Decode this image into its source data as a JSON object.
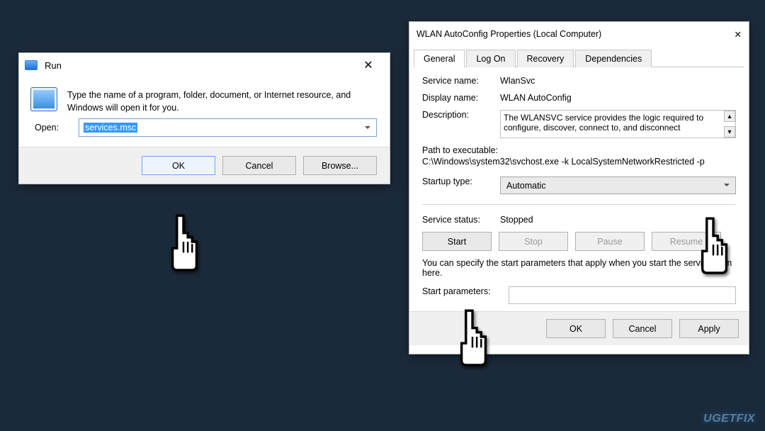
{
  "run": {
    "title": "Run",
    "message": "Type the name of a program, folder, document, or Internet resource, and Windows will open it for you.",
    "open_label": "Open:",
    "open_value": "services.msc",
    "ok": "OK",
    "cancel": "Cancel",
    "browse": "Browse..."
  },
  "props": {
    "title": "WLAN AutoConfig Properties (Local Computer)",
    "tabs": [
      "General",
      "Log On",
      "Recovery",
      "Dependencies"
    ],
    "service_name_label": "Service name:",
    "service_name": "WlanSvc",
    "display_name_label": "Display name:",
    "display_name": "WLAN AutoConfig",
    "description_label": "Description:",
    "description": "The WLANSVC service provides the logic required to configure, discover, connect to, and disconnect",
    "path_label": "Path to executable:",
    "path": "C:\\Windows\\system32\\svchost.exe -k LocalSystemNetworkRestricted -p",
    "startup_type_label": "Startup type:",
    "startup_type": "Automatic",
    "service_status_label": "Service status:",
    "service_status": "Stopped",
    "start": "Start",
    "stop": "Stop",
    "pause": "Pause",
    "resume": "Resume",
    "note": "You can specify the start parameters that apply when you start the service from here.",
    "start_params_label": "Start parameters:",
    "ok": "OK",
    "cancel": "Cancel",
    "apply": "Apply"
  },
  "watermark": "UGETFIX"
}
